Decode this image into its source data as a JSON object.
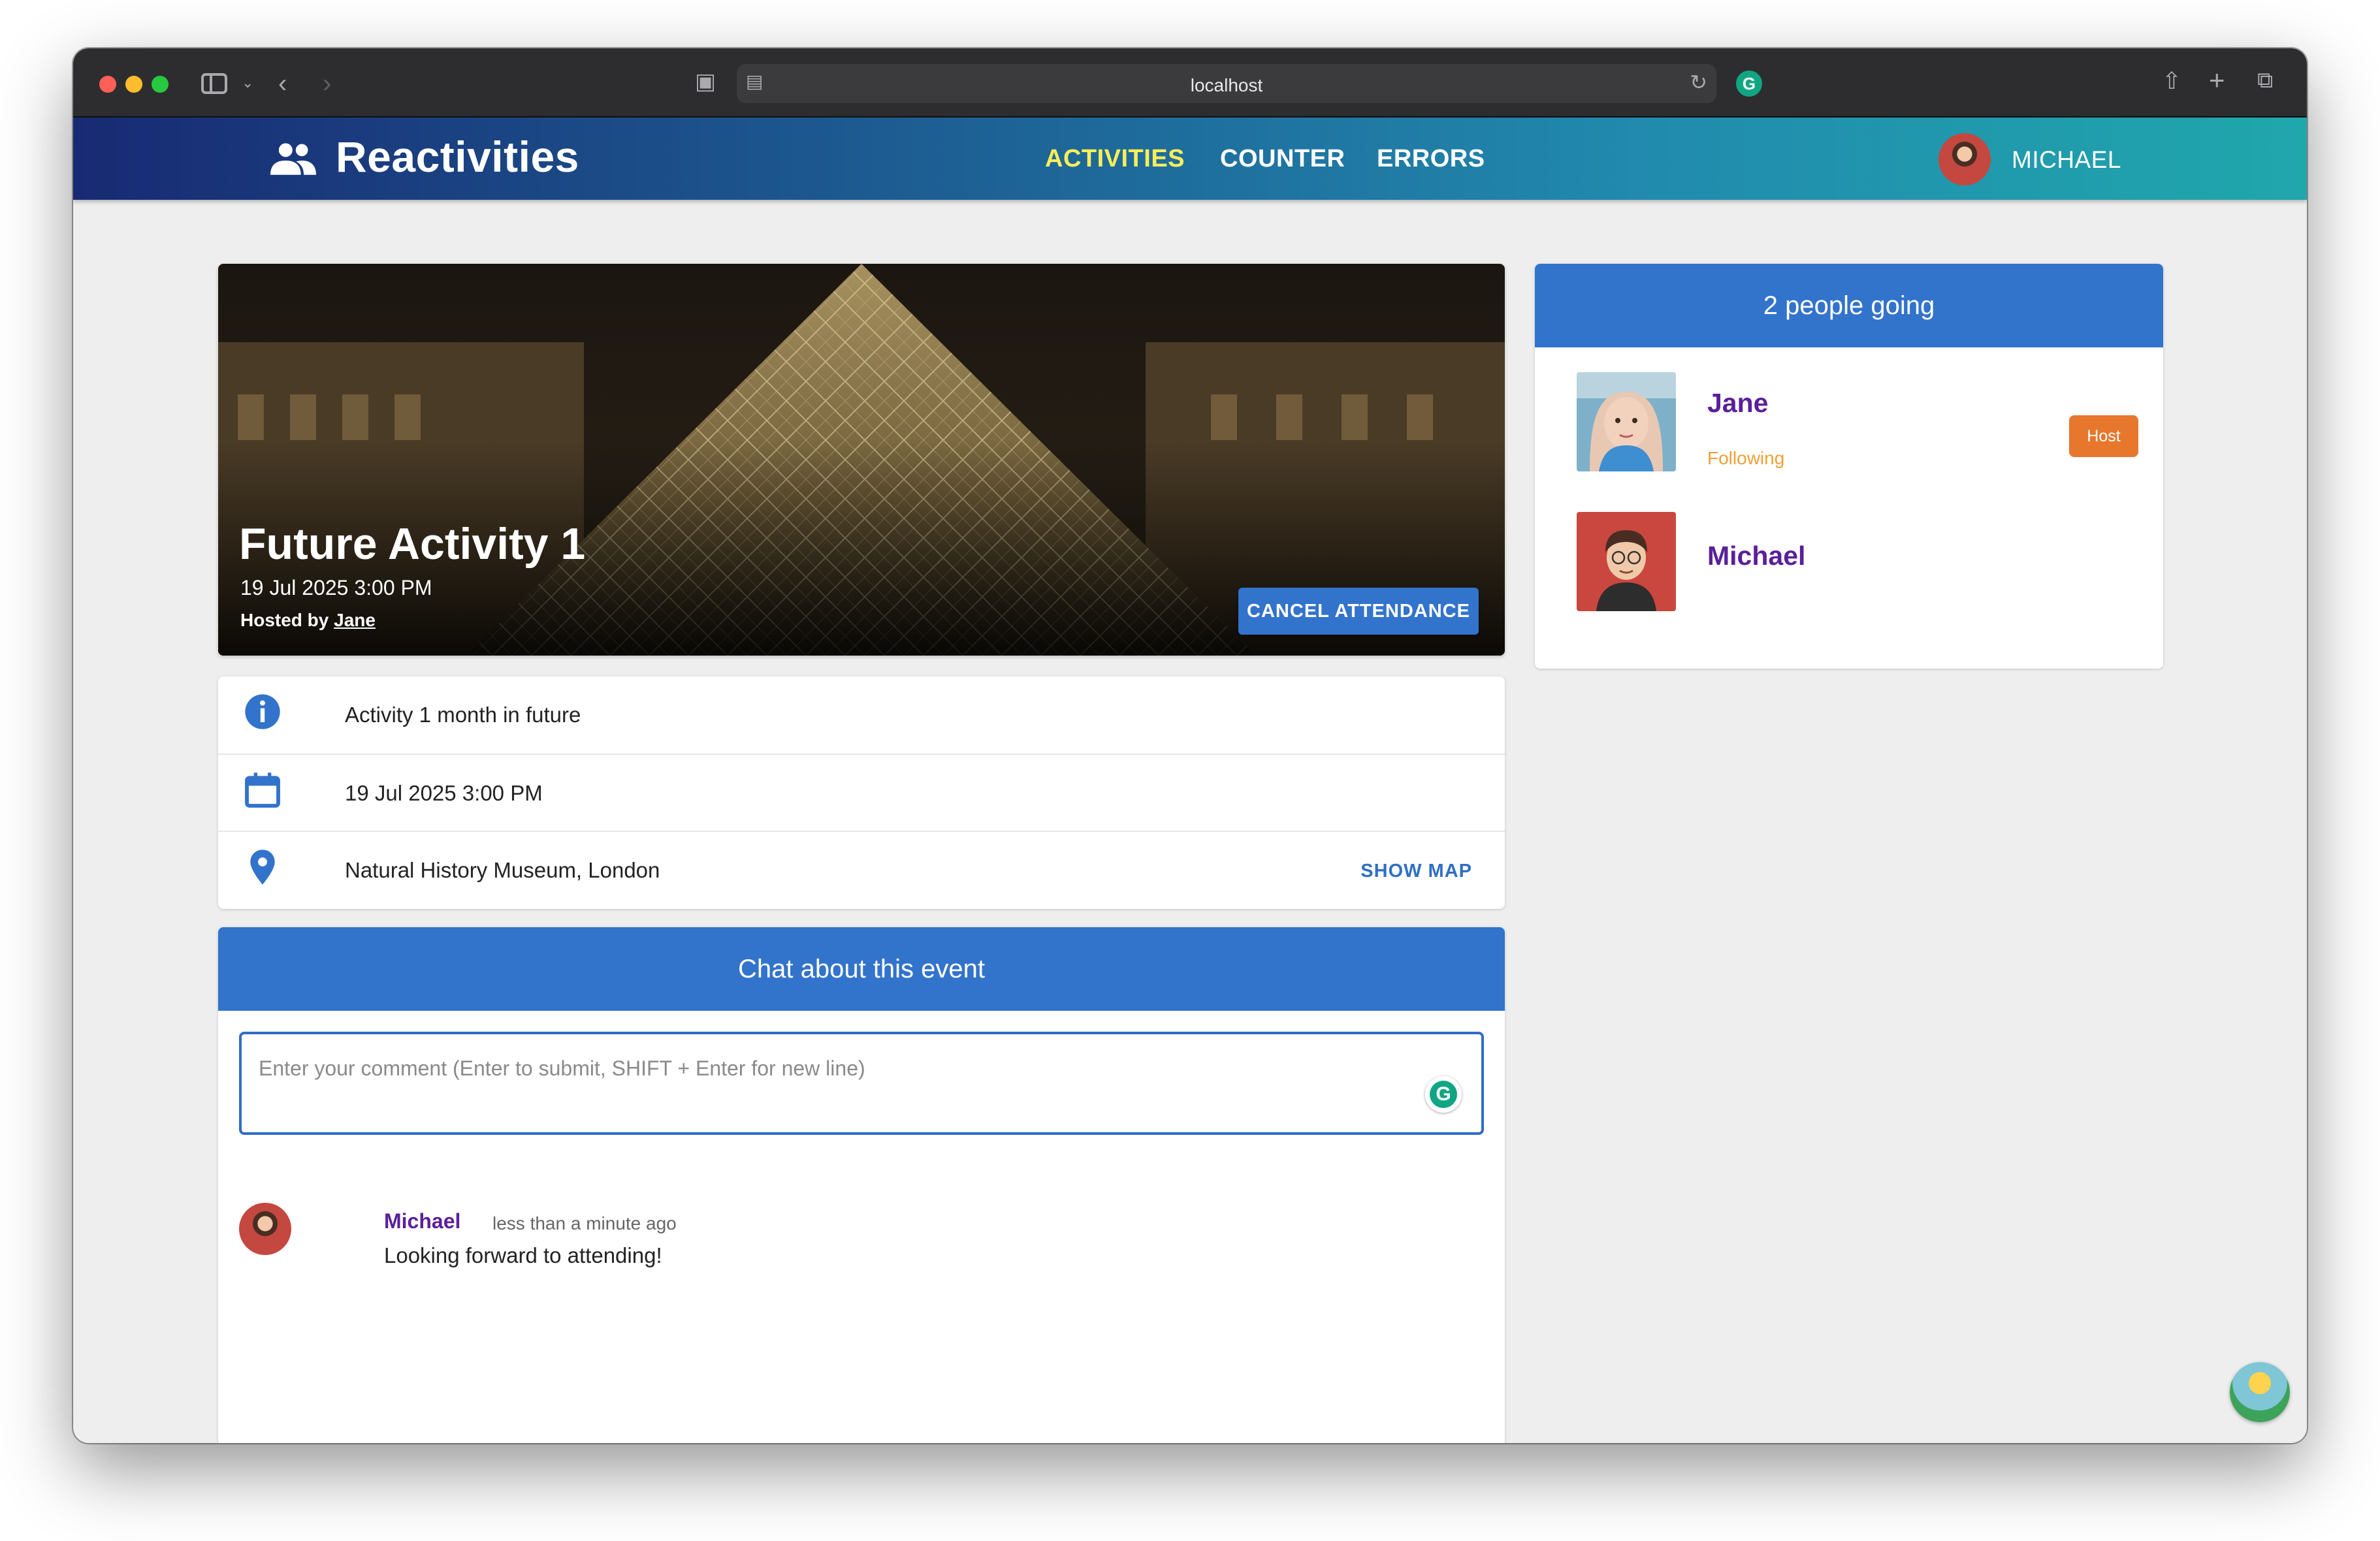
{
  "browser": {
    "url": "localhost"
  },
  "nav": {
    "brand": "Reactivities",
    "links": [
      "ACTIVITIES",
      "COUNTER",
      "ERRORS"
    ],
    "active_link_color": "#ffee58",
    "user": "MICHAEL"
  },
  "activity": {
    "title": "Future Activity 1",
    "date": "19 Jul 2025 3:00 PM",
    "hosted_by_prefix": "Hosted by ",
    "host": "Jane",
    "cancel_button": "CANCEL ATTENDANCE",
    "description": "Activity 1 month in future",
    "date_detail": "19 Jul 2025 3:00 PM",
    "venue": "Natural History Museum, London",
    "show_map": "SHOW MAP"
  },
  "chat": {
    "title": "Chat about this event",
    "placeholder": "Enter your comment (Enter to submit, SHIFT + Enter for new line)",
    "comments": [
      {
        "author": "Michael",
        "time": "less than a minute ago",
        "body": "Looking forward to attending!"
      }
    ]
  },
  "attendees": {
    "title": "2 people going",
    "people": [
      {
        "name": "Jane",
        "status": "Following",
        "badge": "Host"
      },
      {
        "name": "Michael"
      }
    ]
  },
  "colors": {
    "primary": "#3273cc",
    "host_badge": "#e8772e",
    "name": "#5a1f9a"
  }
}
